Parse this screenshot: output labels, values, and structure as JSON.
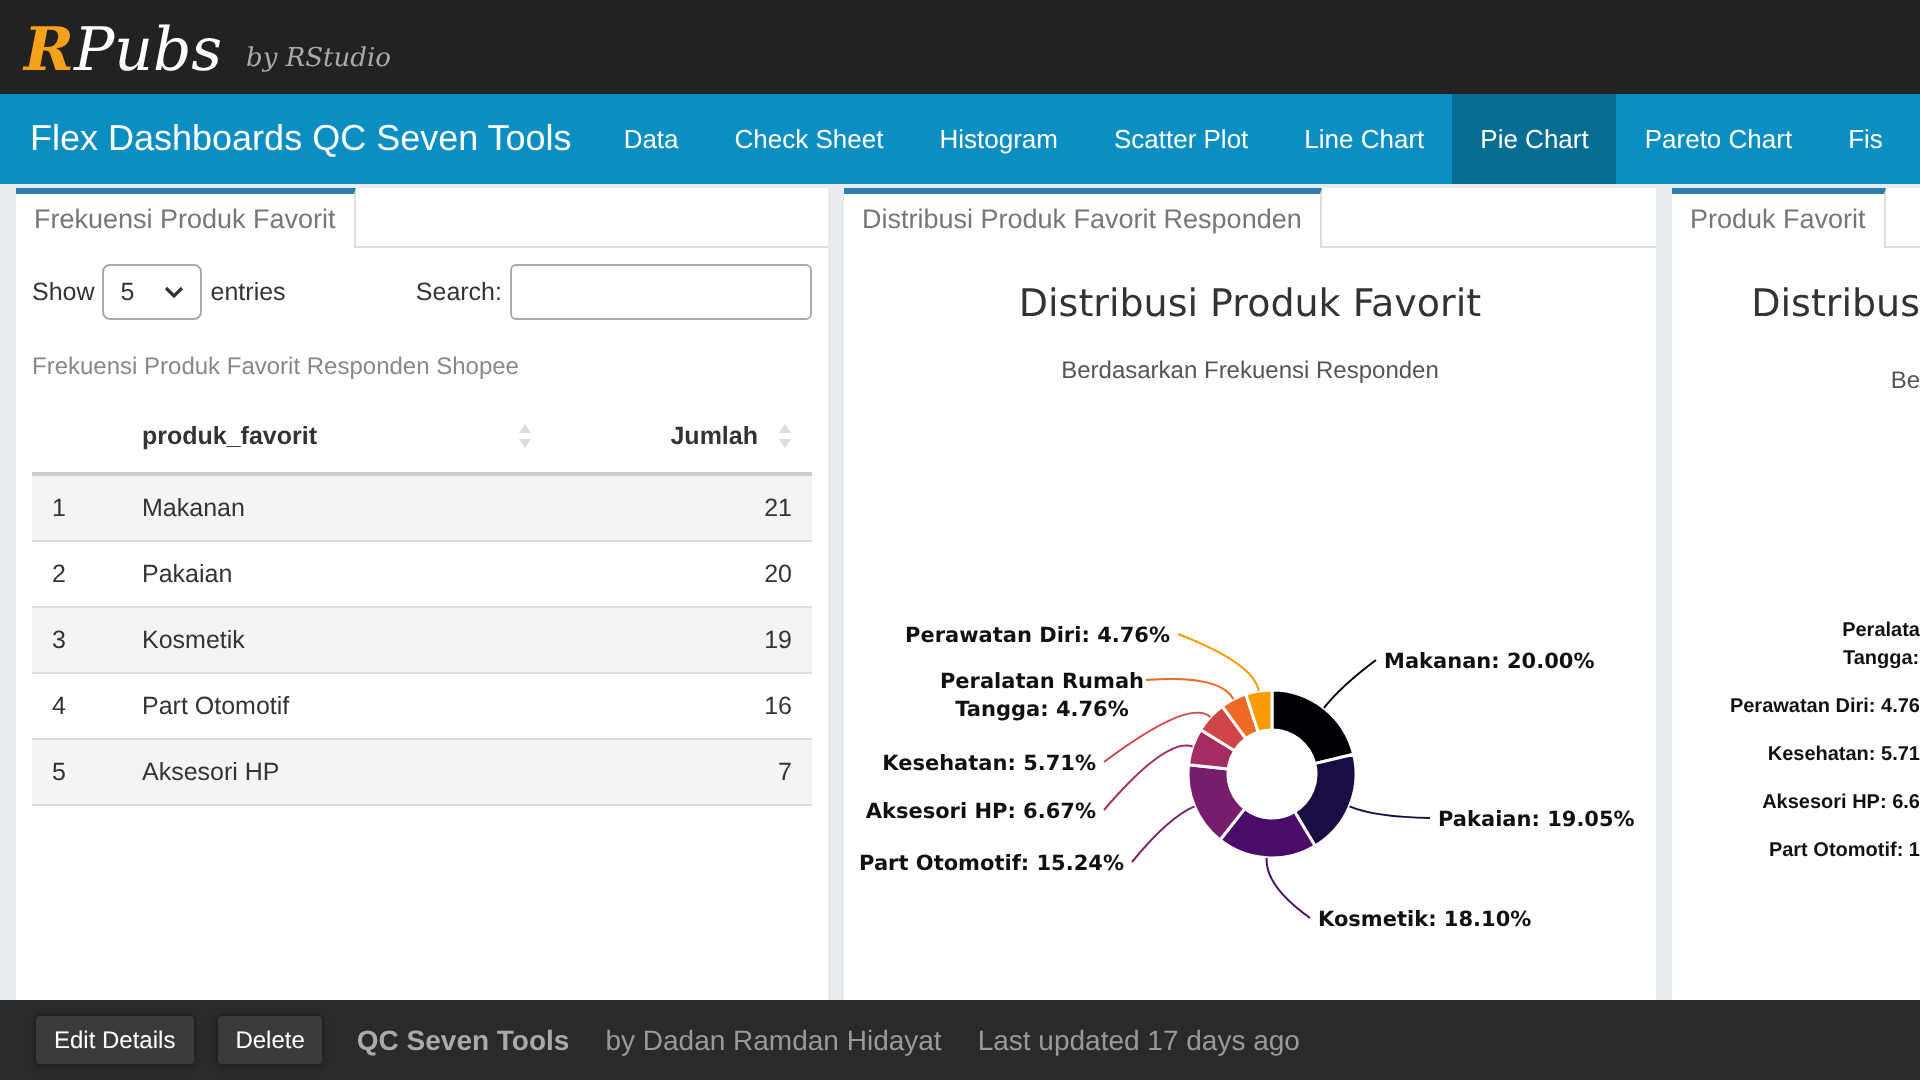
{
  "rpubs": {
    "logo_r": "R",
    "logo_rest": "Pubs",
    "byline": "by RStudio"
  },
  "navbar": {
    "title": "Flex Dashboards QC Seven Tools",
    "items": [
      {
        "label": "Data",
        "selected": false
      },
      {
        "label": "Check Sheet",
        "selected": false
      },
      {
        "label": "Histogram",
        "selected": false
      },
      {
        "label": "Scatter Plot",
        "selected": false
      },
      {
        "label": "Line Chart",
        "selected": false
      },
      {
        "label": "Pie Chart",
        "selected": true
      },
      {
        "label": "Pareto Chart",
        "selected": false
      },
      {
        "label": "Fis",
        "selected": false
      }
    ]
  },
  "table_panel": {
    "tab": "Frekuensi Produk Favorit",
    "show_label": "Show",
    "length_value": "5",
    "entries_label": "entries",
    "search_label": "Search:",
    "caption": "Frekuensi Produk Favorit Responden Shopee",
    "columns": [
      "produk_favorit",
      "Jumlah"
    ],
    "rows": [
      {
        "index": "1",
        "produk": "Makanan",
        "jumlah": "21"
      },
      {
        "index": "2",
        "produk": "Pakaian",
        "jumlah": "20"
      },
      {
        "index": "3",
        "produk": "Kosmetik",
        "jumlah": "19"
      },
      {
        "index": "4",
        "produk": "Part Otomotif",
        "jumlah": "16"
      },
      {
        "index": "5",
        "produk": "Aksesori HP",
        "jumlah": "7"
      }
    ]
  },
  "chart_panel": {
    "tab": "Distribusi Produk Favorit Responden",
    "subtitle": "Berdasarkan Frekuensi Responden",
    "chart_data": {
      "type": "donut",
      "title": "Distribusi Produk Favorit",
      "values": [
        20.0,
        19.05,
        18.1,
        15.24,
        6.67,
        5.71,
        4.76,
        4.76
      ],
      "colors": [
        "#000004",
        "#1b0c41",
        "#4a0c6b",
        "#781c6d",
        "#a52c60",
        "#cf4446",
        "#ed6925",
        "#fb9b06"
      ],
      "value_labels": [
        "Makanan: 20.00%",
        "Pakaian: 19.05%",
        "Kosmetik: 18.10%",
        "Part Otomotif: 15.24%",
        "Aksesori HP: 6.67%",
        "Kesehatan: 5.71%",
        "Peralatan Rumah Tangga: 4.76%",
        "Perawatan Diri: 4.76%"
      ]
    }
  },
  "third_panel": {
    "tab": "Produk Favorit",
    "title": "Distribus",
    "subtitle": "Be",
    "labels": [
      [
        "Peralata",
        "Tangga:"
      ],
      [
        "Perawatan Diri: 4.76"
      ],
      [
        "Kesehatan: 5.71"
      ],
      [
        "Aksesori HP: 6.6"
      ],
      [
        "Part Otomotif: 1"
      ]
    ]
  },
  "footer": {
    "buttons": [
      "Edit Details",
      "Delete"
    ],
    "doc_title": "QC Seven Tools",
    "author": "by Dadan Ramdan Hidayat",
    "updated": "Last updated 17 days ago"
  }
}
